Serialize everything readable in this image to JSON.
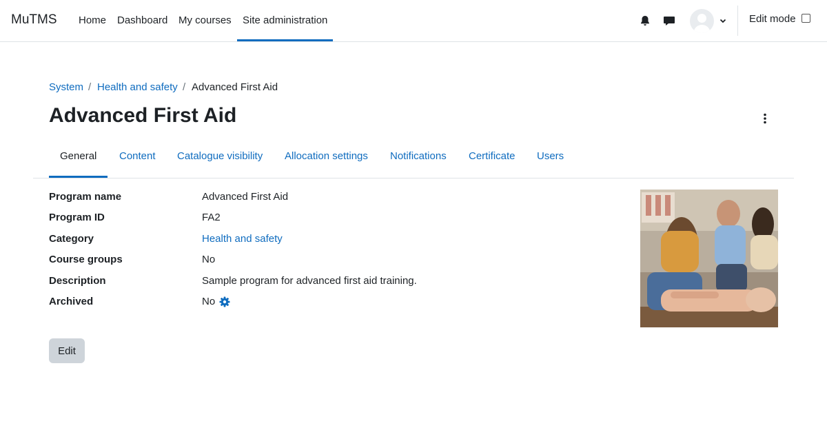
{
  "navbar": {
    "brand": "MuTMS",
    "links": [
      "Home",
      "Dashboard",
      "My courses",
      "Site administration"
    ],
    "active_link": "Site administration",
    "edit_mode_label": "Edit mode",
    "edit_mode_checked": false,
    "icons": [
      "bell-icon",
      "chat-icon",
      "user-avatar",
      "chevron-down-icon"
    ]
  },
  "breadcrumb": {
    "items": [
      "System",
      "Health and safety",
      "Advanced First Aid"
    ],
    "separator": "/"
  },
  "page": {
    "title": "Advanced First Aid"
  },
  "tabs": {
    "items": [
      "General",
      "Content",
      "Catalogue visibility",
      "Allocation settings",
      "Notifications",
      "Certificate",
      "Users"
    ],
    "active": "General"
  },
  "details": {
    "rows": [
      {
        "label": "Program name",
        "value": "Advanced First Aid"
      },
      {
        "label": "Program ID",
        "value": "FA2"
      },
      {
        "label": "Category",
        "value": "Health and safety"
      },
      {
        "label": "Course groups",
        "value": "No"
      },
      {
        "label": "Description",
        "value": "Sample program for advanced first aid training."
      },
      {
        "label": "Archived",
        "value": "No"
      }
    ]
  },
  "actions": {
    "edit_label": "Edit"
  },
  "colors": {
    "accent": "#0f6cbf",
    "text": "#1d2125",
    "button_bg": "#ced4da",
    "border": "#dee2e6"
  }
}
